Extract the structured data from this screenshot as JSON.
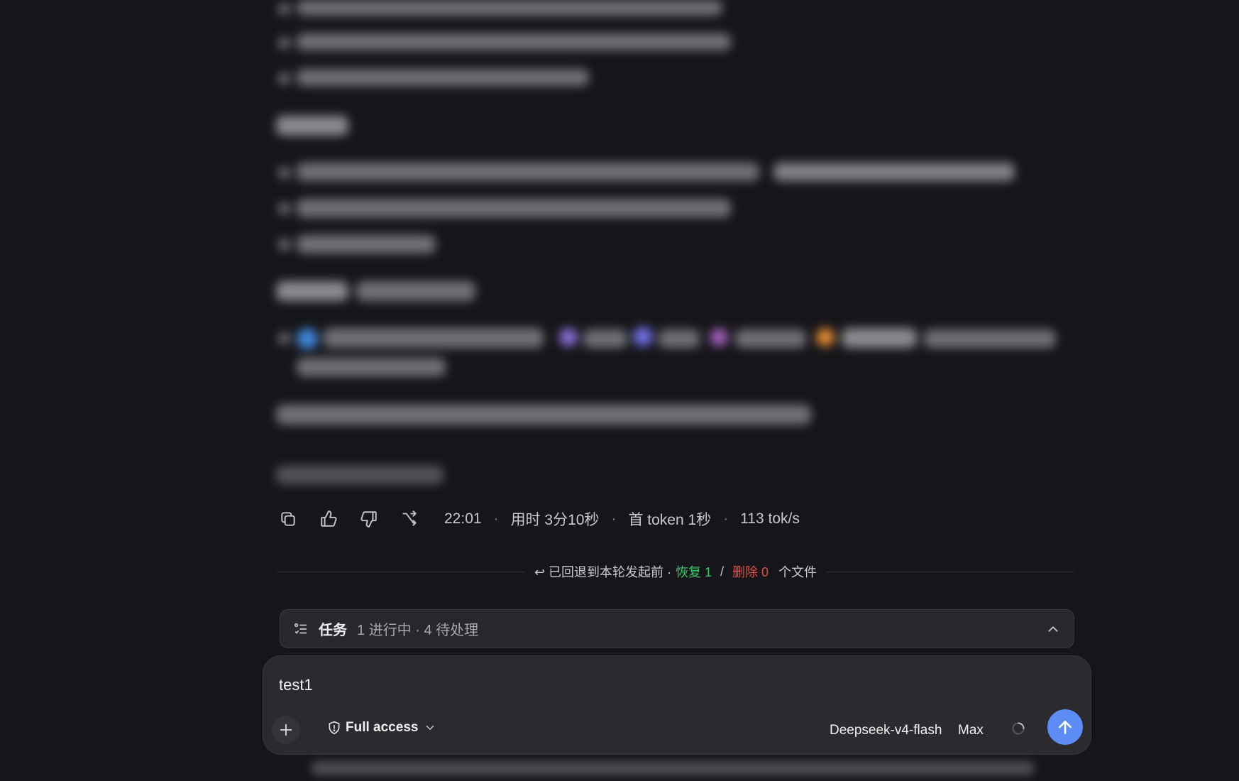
{
  "message": {
    "time": "22:01",
    "duration": "用时 3分10秒",
    "first_token": "首 token 1秒",
    "speed": "113 tok/s",
    "separator": "·"
  },
  "rollback": {
    "text": "↩ 已回退到本轮发起前 ·",
    "restore": "恢复 1",
    "slash": "/",
    "delete": "删除 0",
    "suffix": "个文件"
  },
  "tasks": {
    "title": "任务",
    "status": "1 进行中 · 4 待处理"
  },
  "composer": {
    "input_value": "test1",
    "access_label": "Full access",
    "model": "Deepseek-v4-flash",
    "effort": "Max"
  },
  "colors": {
    "background": "#16161a",
    "restore": "#3ec96a",
    "delete": "#e0504a",
    "send": "#5b8df5"
  },
  "icons": [
    "copy-icon",
    "thumbs-up-icon",
    "thumbs-down-icon",
    "branch-icon",
    "task-list-icon",
    "chevron-up-icon",
    "plus-icon",
    "shield-icon",
    "chevron-down-icon",
    "spinner-icon",
    "arrow-up-icon"
  ]
}
